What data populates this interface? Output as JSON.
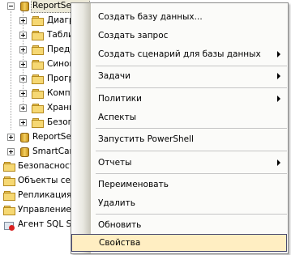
{
  "tree": {
    "db_reportserver": "ReportServer",
    "child_folders": [
      "Диаграммы",
      "Таблицы",
      "Представления",
      "Синонимы",
      "Программирование",
      "Компонент Service Broker",
      "Хранилище",
      "Безопасность"
    ],
    "db_reportserver_tempdb": "ReportServerTempDB",
    "db_smartcard": "SmartCard",
    "top_folders": [
      "Безопасность",
      "Объекты сервера",
      "Репликация",
      "Управление"
    ],
    "agent": "Агент SQL Server"
  },
  "context_menu": {
    "items": [
      {
        "label": "Создать базу данных...",
        "submenu": false
      },
      {
        "label": "Создать запрос",
        "submenu": false
      },
      {
        "label": "Создать сценарий для базы данных",
        "submenu": true
      },
      {
        "label": "Задачи",
        "submenu": true
      },
      {
        "label": "Политики",
        "submenu": true
      },
      {
        "label": "Аспекты",
        "submenu": false
      },
      {
        "label": "Запустить PowerShell",
        "submenu": false
      },
      {
        "label": "Отчеты",
        "submenu": true
      },
      {
        "label": "Переименовать",
        "submenu": false
      },
      {
        "label": "Удалить",
        "submenu": false
      },
      {
        "label": "Обновить",
        "submenu": false
      },
      {
        "label": "Свойства",
        "submenu": false,
        "highlighted": true
      }
    ]
  },
  "colors": {
    "highlight_bg": "#ffeec2",
    "highlight_border": "#4b4b6f",
    "folder": "#f6d873",
    "db_gold": "#f4d060"
  }
}
